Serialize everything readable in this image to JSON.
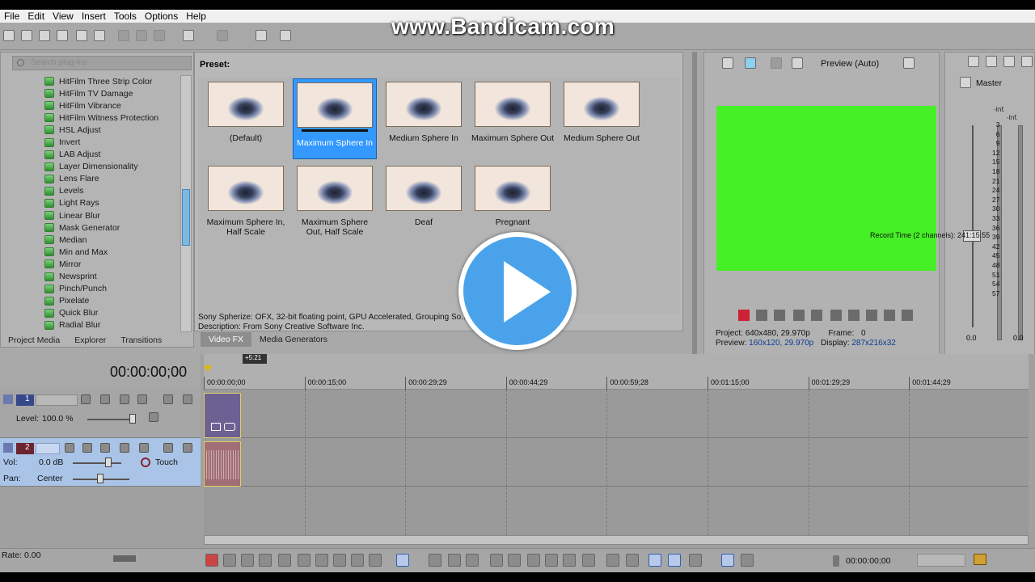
{
  "menu": [
    "File",
    "Edit",
    "View",
    "Insert",
    "Tools",
    "Options",
    "Help"
  ],
  "watermark": "www.Bandicam.com",
  "plugins": {
    "search_placeholder": "Search plug-ins",
    "items": [
      "HitFilm Three Strip Color",
      "HitFilm TV Damage",
      "HitFilm Vibrance",
      "HitFilm Witness Protection",
      "HSL Adjust",
      "Invert",
      "LAB Adjust",
      "Layer Dimensionality",
      "Lens Flare",
      "Levels",
      "Light Rays",
      "Linear Blur",
      "Mask Generator",
      "Median",
      "Min and Max",
      "Mirror",
      "Newsprint",
      "Pinch/Punch",
      "Pixelate",
      "Quick Blur",
      "Radial Blur"
    ]
  },
  "tabs": [
    "Project Media",
    "Explorer",
    "Transitions",
    "Video FX",
    "Media Generators"
  ],
  "active_tab": "Video FX",
  "preset": {
    "label": "Preset:",
    "items": [
      {
        "name": "(Default)"
      },
      {
        "name": "Maximum Sphere In"
      },
      {
        "name": "Medium Sphere In"
      },
      {
        "name": "Maximum Sphere Out"
      },
      {
        "name": "Medium Sphere Out"
      },
      {
        "name": "Maximum Sphere In, Half Scale"
      },
      {
        "name": "Maximum Sphere Out, Half Scale"
      },
      {
        "name": "Deaf"
      },
      {
        "name": "Pregnant"
      }
    ],
    "selected": "Maximum Sphere In",
    "description_line1": "Sony Spherize: OFX, 32-bit floating point, GPU Accelerated, Grouping So...",
    "description_line2": "Description: From Sony Creative Software Inc."
  },
  "preview": {
    "label": "Preview (Auto)",
    "project_label": "Project:",
    "project_value": "640x480, 29.970p",
    "frame_label": "Frame:",
    "frame_value": "0",
    "preview_label": "Preview:",
    "preview_value": "160x120, 29.970p",
    "display_label": "Display:",
    "display_value": "287x216x32",
    "screen_color": "#46f026"
  },
  "master": {
    "label": "Master",
    "inf_left": "-Inf.",
    "inf_right": "-Inf.",
    "scale": [
      "3",
      "6",
      "9",
      "12",
      "15",
      "18",
      "21",
      "24",
      "27",
      "30",
      "33",
      "36",
      "39",
      "42",
      "45",
      "48",
      "51",
      "54",
      "57"
    ],
    "zero_left": "0.0",
    "zero_right": "0.0"
  },
  "timeline": {
    "timecode": "00:00:00;00",
    "marker": "+5:21",
    "ruler": [
      "00:00:00;00",
      "00:00:15;00",
      "00:00:29;29",
      "00:00:44;29",
      "00:00:59;28",
      "00:01:15;00",
      "00:01:29;29",
      "00:01:44;29"
    ],
    "track1": {
      "number": "1",
      "level_label": "Level:",
      "level_value": "100.0 %"
    },
    "track2": {
      "number": "2",
      "vol_label": "Vol:",
      "vol_value": "0.0 dB",
      "pan_label": "Pan:",
      "pan_value": "Center",
      "automation": "Touch"
    },
    "rate": "Rate: 0.00",
    "bottom_timecode": "00:00:00;00",
    "record_time": "Record Time (2 channels): 241:15:55"
  }
}
